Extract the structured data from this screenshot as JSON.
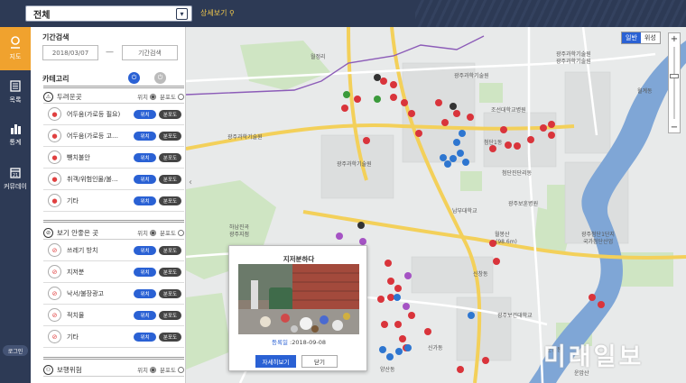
{
  "header": {
    "region_value": "전체",
    "detail_link": "상세보기"
  },
  "nav": {
    "items": [
      {
        "label": "지도"
      },
      {
        "label": "목록"
      },
      {
        "label": "통계"
      },
      {
        "label": "커뮤데이"
      }
    ],
    "login": "로그인"
  },
  "panel": {
    "period_title": "기간검색",
    "start_date": "2018/03/07",
    "end_date": "기간검색",
    "category_title": "카테고리",
    "group_options": {
      "position": "위치",
      "distribution": "분포도"
    },
    "item_buttons": {
      "position": "위치",
      "distribution": "분포도"
    },
    "groups": [
      {
        "name": "두려운곳",
        "items": [
          "어두움(가로등 필요)",
          "어두움(가로등 고…",
          "뺑치불안",
          "취객/위험인물/불…",
          "기타"
        ]
      },
      {
        "name": "보기 안좋은 곳",
        "items": [
          "쓰레기 방치",
          "지저분",
          "낙서/불장광고",
          "적치물",
          "기타"
        ]
      },
      {
        "name": "보행위험",
        "items": []
      }
    ]
  },
  "map": {
    "type_options": [
      "일반",
      "위성"
    ],
    "selected_type": "일반",
    "zoom_level": 0.6,
    "place_labels": [
      "월정리",
      "월계동",
      "광주과학기술원",
      "광주과학기술원",
      "광주과학기술원",
      "조선대학교병원",
      "첨단1동",
      "광주과학기술원",
      "광주과학기술원",
      "첨단진단리동",
      "남부대학교",
      "광주보훈병원",
      "월봉산",
      "(98.6m)",
      "광주첨단1단지",
      "국가첨단산업",
      "신창동",
      "광주보건대학교",
      "운암산",
      "하남진곡",
      "광주지점",
      "신가동",
      "양산동",
      "운남동"
    ]
  },
  "popup": {
    "title": "지저분하다",
    "date_label": "등록일",
    "date_value": ":2018-09-08",
    "more_button": "자세히보기",
    "close_button": "닫기"
  },
  "watermark": "미래일보",
  "colors": {
    "nav_bg": "#2d3a55",
    "nav_active": "#f0a22e",
    "accent_blue": "#2a61d4",
    "river": "#7fa6d6",
    "road_yellow": "#f3d05a",
    "pin_red": "#d9343b",
    "pin_blue": "#2e76d0",
    "pin_purple": "#a553c4",
    "pin_green": "#3b9a3b"
  }
}
